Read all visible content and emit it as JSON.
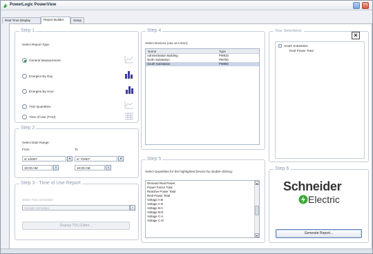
{
  "window": {
    "title": "PowerLogic PowerView"
  },
  "tabs": [
    {
      "label": "Real Time Display"
    },
    {
      "label": "Report Builder"
    },
    {
      "label": "Setup"
    }
  ],
  "step1": {
    "title": "Step 1",
    "select_label": "Select Report Type:",
    "options": [
      {
        "label": "General Measurement",
        "checked": true
      },
      {
        "label": "Energies By Day",
        "checked": false
      },
      {
        "label": "Energies By Hour",
        "checked": false
      },
      {
        "label": "THD Quantities",
        "checked": false
      },
      {
        "label": "Time of Use (TOU)",
        "checked": false
      }
    ]
  },
  "step2": {
    "title": "Step 2",
    "date_range_label": "Select Date Range:",
    "from_label": "From",
    "to_label": "To",
    "from_date": "4/ 1/2007",
    "to_date": "4/ 7/2007",
    "from_time": "10:00 AM",
    "to_time": "10:00 AM"
  },
  "step3": {
    "title": "Step 3 - Time of Use Report",
    "schedule_label": "Select TOU Schedule:",
    "schedule_value": "Sample Schedule",
    "edit_button": "Display TOU Editor..."
  },
  "step4": {
    "title": "Step 4",
    "instruction": "Select Devices (one at a time):",
    "columns": [
      "Name",
      "Type"
    ],
    "devices": [
      {
        "name": "Administration Building",
        "type": "PM810",
        "selected": false
      },
      {
        "name": "North Substation",
        "type": "PM750",
        "selected": false
      },
      {
        "name": "South Substation",
        "type": "PM850",
        "selected": true
      }
    ]
  },
  "step5": {
    "title": "Step 5",
    "instruction": "Select Quantities for the highlighted Device by double-clicking:",
    "quantities": [
      "Demand Real Power",
      "Power Factor Total",
      "Reactive Power Total",
      "Real Power Total",
      "Voltage A-B",
      "Voltage A-N",
      "Voltage B-C",
      "Voltage B-N",
      "Voltage C-A",
      "Voltage C-N"
    ]
  },
  "selections": {
    "title": "Your Selections:",
    "tree_parent": "South Substation",
    "tree_child": "Real Power Total"
  },
  "step6": {
    "title": "Step 6",
    "brand_top": "Schneider",
    "brand_bottom": "Electric",
    "generate_button": "Generate Report..."
  },
  "colors": {
    "group_title": "#8a9ab0",
    "brand_green": "#3aa935",
    "selection_bg": "#c9d5e8"
  }
}
